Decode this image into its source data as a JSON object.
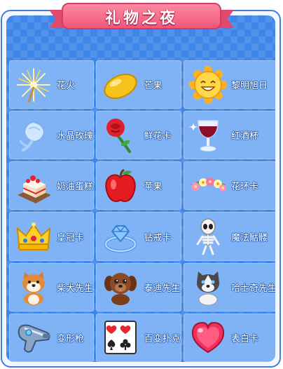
{
  "title": "礼物之夜",
  "gifts": [
    {
      "label": "花火",
      "icon": "firework-icon"
    },
    {
      "label": "芒果",
      "icon": "mango-icon"
    },
    {
      "label": "黎明旭日",
      "icon": "sun-icon"
    },
    {
      "label": "水晶玫瑰",
      "icon": "crystal-rose-icon"
    },
    {
      "label": "鲜花卡",
      "icon": "red-rose-icon"
    },
    {
      "label": "红酒杯",
      "icon": "wine-glass-icon"
    },
    {
      "label": "奶油蛋糕",
      "icon": "cake-icon"
    },
    {
      "label": "苹果",
      "icon": "apple-icon"
    },
    {
      "label": "花环卡",
      "icon": "flower-wreath-icon"
    },
    {
      "label": "皇冠卡",
      "icon": "crown-icon"
    },
    {
      "label": "钻戒卡",
      "icon": "diamond-ring-icon"
    },
    {
      "label": "魔法骷髅",
      "icon": "skeleton-icon"
    },
    {
      "label": "柴犬先生",
      "icon": "shiba-dog-icon"
    },
    {
      "label": "泰迪先生",
      "icon": "teddy-dog-icon"
    },
    {
      "label": "哈士奇先生",
      "icon": "husky-dog-icon"
    },
    {
      "label": "变形枪",
      "icon": "ray-gun-icon"
    },
    {
      "label": "百变扑克",
      "icon": "poker-cards-icon"
    },
    {
      "label": "表白卡",
      "icon": "heart-icon"
    }
  ]
}
